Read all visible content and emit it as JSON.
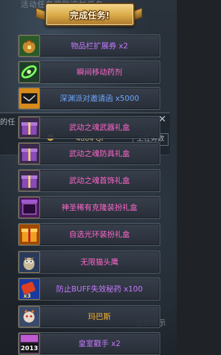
{
  "background": {
    "top_text": "活动任务奖励追加任务",
    "panel_left_label": "的任",
    "qf_amount": "4004 QF",
    "panel_button": "上任务数",
    "hint": "任务提示"
  },
  "banner": {
    "title": "完成任务!"
  },
  "colors": {
    "purple": "#c57aff",
    "blue": "#6ea8ff",
    "orange": "#ffb52e",
    "pink": "#ff66cc"
  },
  "rewards": [
    {
      "label": "物品栏扩展券 x2",
      "color": "#c57aff",
      "icon": "bag-expand-icon"
    },
    {
      "label": "瞬间移动药剂",
      "color": "#ff66cc",
      "icon": "teleport-potion-icon"
    },
    {
      "label": "深渊派对邀请函 x5000",
      "color": "#6ea8ff",
      "icon": "abyss-invitation-icon"
    },
    {
      "label": "武动之魂武器礼盒",
      "color": "#ff66cc",
      "icon": "purple-gift-box-icon"
    },
    {
      "label": "武动之魂防具礼盒",
      "color": "#ff66cc",
      "icon": "purple-gift-box-icon"
    },
    {
      "label": "武动之魂首饰礼盒",
      "color": "#ff66cc",
      "icon": "purple-gift-box-icon"
    },
    {
      "label": "神圣稀有克隆装扮礼盒",
      "color": "#ff66cc",
      "icon": "clone-avatar-box-icon"
    },
    {
      "label": "自选光环装扮礼盒",
      "color": "#ff66cc",
      "icon": "aura-gift-box-icon"
    },
    {
      "label": "无限猫头鹰",
      "color": "#ff66cc",
      "icon": "owl-icon"
    },
    {
      "label": "防止BUFF失效秘药 x100",
      "color": "#c57aff",
      "icon": "buff-potion-icon"
    },
    {
      "label": "玛巴斯",
      "color": "#ffb52e",
      "icon": "marbas-pet-icon"
    },
    {
      "label": "皇室戳手 x2",
      "color": "#c57aff",
      "icon": "royal-2013-icon",
      "icon_text": "2013"
    }
  ]
}
